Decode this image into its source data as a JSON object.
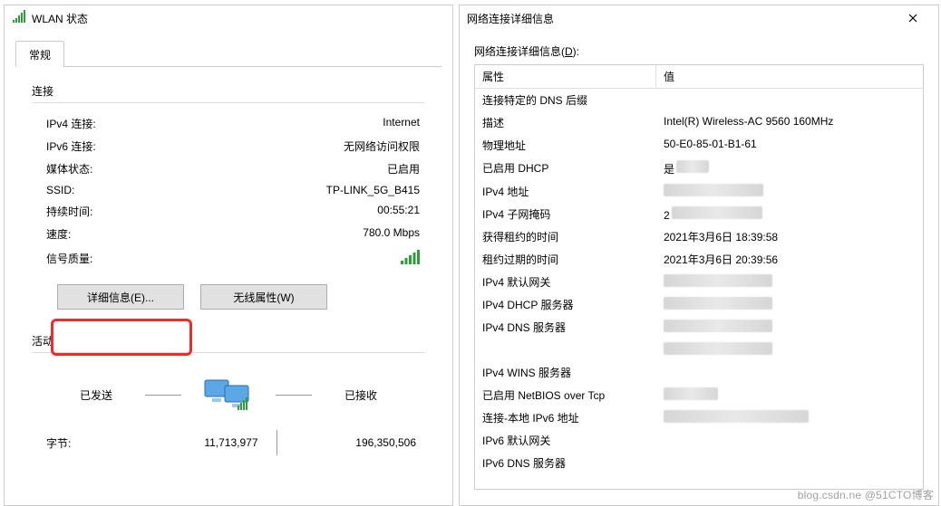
{
  "wlan": {
    "title": "WLAN 状态",
    "tab_general": "常规",
    "group_connection": "连接",
    "group_activity": "活动",
    "rows": {
      "ipv4_label": "IPv4 连接:",
      "ipv4_value": "Internet",
      "ipv6_label": "IPv6 连接:",
      "ipv6_value": "无网络访问权限",
      "media_label": "媒体状态:",
      "media_value": "已启用",
      "ssid_label": "SSID:",
      "ssid_value": "TP-LINK_5G_B415",
      "duration_label": "持续时间:",
      "duration_value": "00:55:21",
      "speed_label": "速度:",
      "speed_value": "780.0 Mbps",
      "signal_label": "信号质量:"
    },
    "buttons": {
      "details": "详细信息(E)...",
      "wireless_props": "无线属性(W)"
    },
    "activity": {
      "sent_label": "已发送",
      "recv_label": "已接收",
      "bytes_label": "字节:",
      "bytes_sent": "11,713,977",
      "bytes_recv": "196,350,506"
    }
  },
  "details": {
    "title": "网络连接详细信息",
    "caption_prefix": "网络连接详细信息(",
    "caption_ul": "D",
    "caption_suffix": "):",
    "header_attr": "属性",
    "header_val": "值",
    "rows": [
      {
        "attr": "连接特定的 DNS 后缀",
        "val": ""
      },
      {
        "attr": "描述",
        "val": "Intel(R) Wireless-AC 9560 160MHz"
      },
      {
        "attr": "物理地址",
        "val": "50-E0-85-01-B1-61"
      },
      {
        "attr": "已启用 DHCP",
        "val": "是",
        "blur": true,
        "blurWidth": 36
      },
      {
        "attr": "IPv4 地址",
        "val": "",
        "blur": true,
        "blurWidth": 110
      },
      {
        "attr": "IPv4 子网掩码",
        "val": "2",
        "blur": true,
        "blurWidth": 100
      },
      {
        "attr": "获得租约的时间",
        "val": "2021年3月6日 18:39:58"
      },
      {
        "attr": "租约过期的时间",
        "val": "2021年3月6日 20:39:56"
      },
      {
        "attr": "IPv4 默认网关",
        "val": "",
        "blur": true,
        "blurWidth": 120
      },
      {
        "attr": "IPv4 DHCP 服务器",
        "val": "",
        "blur": true,
        "blurWidth": 120
      },
      {
        "attr": "IPv4 DNS 服务器",
        "val": "",
        "blur": true,
        "blurWidth": 120
      },
      {
        "attr": "",
        "val": "",
        "blur": true,
        "blurWidth": 120
      },
      {
        "attr": "IPv4 WINS 服务器",
        "val": ""
      },
      {
        "attr": "已启用 NetBIOS over Tcp",
        "val": "",
        "blur": true,
        "blurWidth": 60
      },
      {
        "attr": "连接-本地 IPv6 地址",
        "val": "",
        "blur": true,
        "blurWidth": 160
      },
      {
        "attr": "IPv6 默认网关",
        "val": ""
      },
      {
        "attr": "IPv6 DNS 服务器",
        "val": ""
      }
    ]
  },
  "watermark": "blog.csdn.ne @51CTO博客"
}
